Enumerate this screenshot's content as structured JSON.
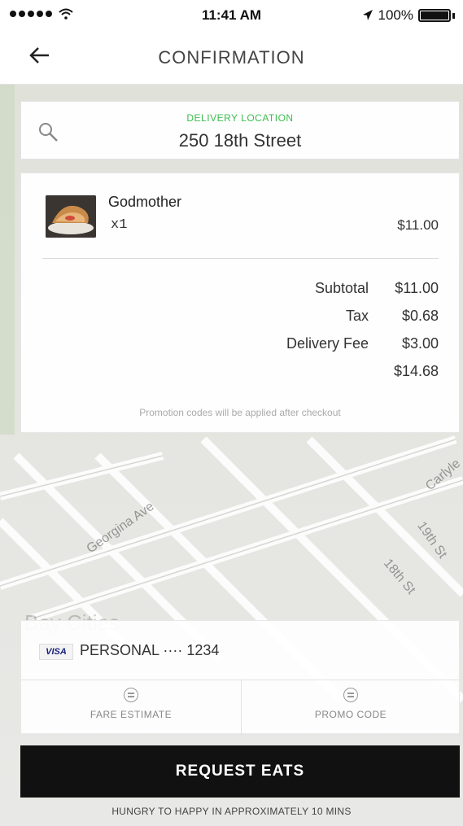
{
  "status_bar": {
    "time": "11:41 AM",
    "battery": "100%"
  },
  "header": {
    "title": "CONFIRMATION",
    "back_icon": "arrow-left-icon"
  },
  "location": {
    "label": "DELIVERY LOCATION",
    "value": "250 18th Street",
    "label_color": "#3dbd4f"
  },
  "order": {
    "items": [
      {
        "name": "Godmother",
        "qty": "x1",
        "price": "$11.00"
      }
    ],
    "subtotal_label": "Subtotal",
    "subtotal": "$11.00",
    "tax_label": "Tax",
    "tax": "$0.68",
    "delivery_label": "Delivery Fee",
    "delivery": "$3.00",
    "total": "$14.68",
    "promo_note": "Promotion codes will be applied after checkout"
  },
  "map": {
    "streets": [
      "Georgina Ave",
      "19th St",
      "18th St",
      "Carlyle"
    ],
    "background_text": "Bay Cities"
  },
  "payment": {
    "card_brand": "VISA",
    "label": "PERSONAL ···· 1234",
    "fare_estimate": "FARE ESTIMATE",
    "promo_code": "PROMO CODE"
  },
  "actions": {
    "request_label": "REQUEST EATS",
    "eta_note": "HUNGRY TO HAPPY IN APPROXIMATELY 10 MINS"
  }
}
